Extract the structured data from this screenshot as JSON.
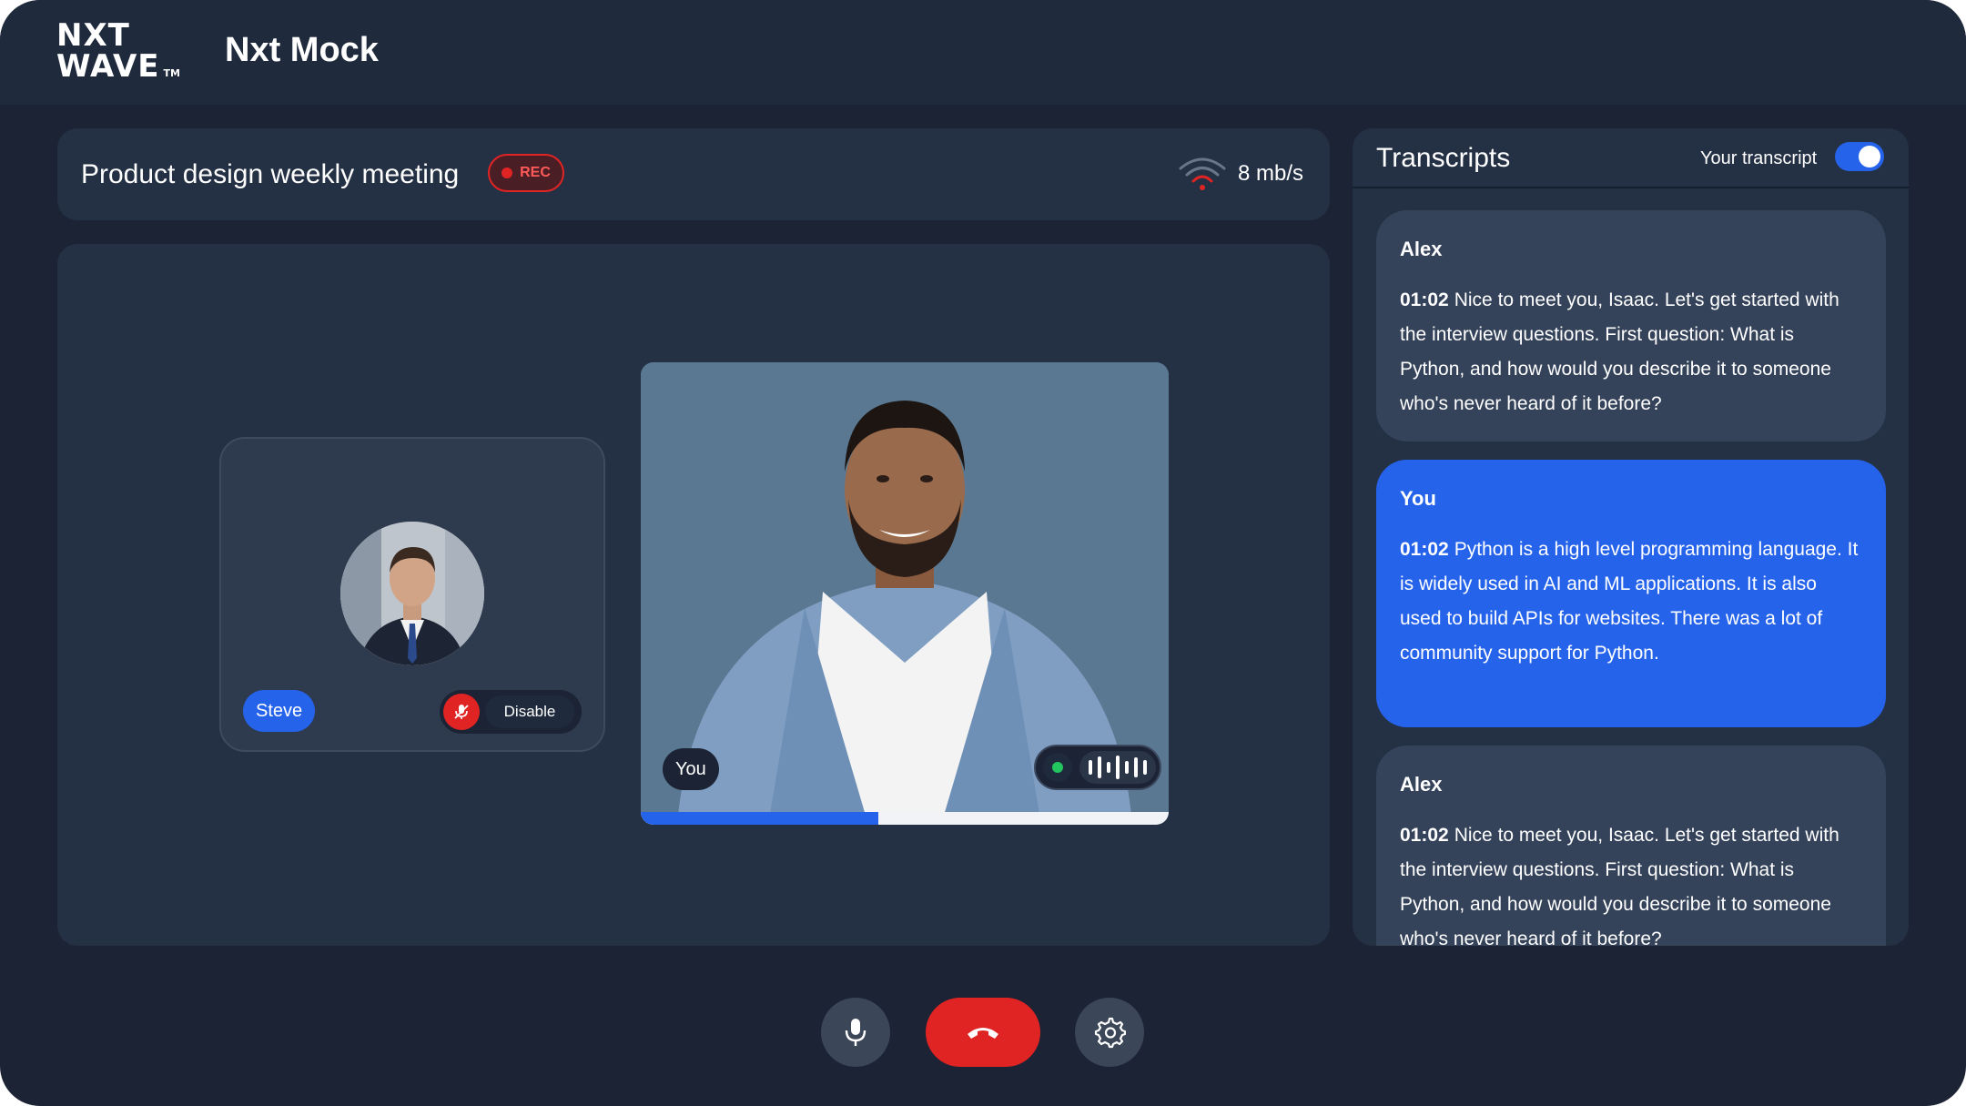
{
  "header": {
    "logo_line1": "NXT",
    "logo_line2": "WAVE",
    "logo_tm": "TM",
    "app_title": "Nxt Mock"
  },
  "meeting": {
    "title": "Product design weekly meeting",
    "rec_label": "REC",
    "network_speed": "8 mb/s"
  },
  "participants": {
    "remote": {
      "name": "Steve",
      "mic_state": "muted",
      "disable_label": "Disable"
    },
    "local": {
      "name": "You",
      "progress": 0.45
    }
  },
  "transcripts": {
    "title": "Transcripts",
    "toggle_label": "Your transcript",
    "toggle_on": true,
    "messages": [
      {
        "speaker": "Alex",
        "time": "01:02",
        "text": "Nice to meet you, Isaac. Let's get started with the interview questions. First question: What is Python, and how would you describe it to someone who's never heard of it before?"
      },
      {
        "speaker": "You",
        "time": "01:02",
        "text": "Python is a high level programming language. It is widely used in AI and ML applications. It is also used to build APIs for websites. There was a lot of community support for Python."
      },
      {
        "speaker": "Alex",
        "time": "01:02",
        "text": "Nice to meet you, Isaac. Let's get started with the interview questions. First question: What is Python, and how would you describe it to someone who's never heard of it before?"
      }
    ]
  },
  "controls": {
    "mic_icon": "microphone-icon",
    "end_call_icon": "phone-hangup-icon",
    "settings_icon": "gear-icon"
  },
  "colors": {
    "background": "#1b2334",
    "panel": "#243044",
    "accent": "#2563eb",
    "danger": "#e02424",
    "live": "#22c55e"
  }
}
